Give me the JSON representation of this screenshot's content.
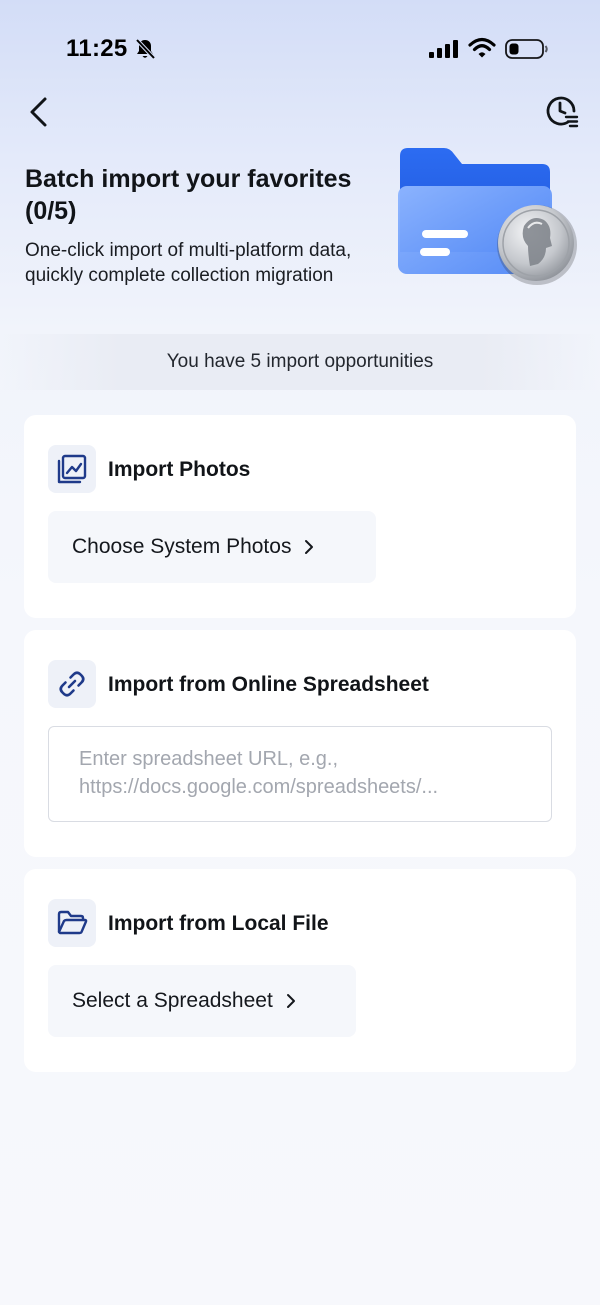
{
  "status_bar": {
    "time": "11:25",
    "icons": [
      "bell-slash-icon",
      "cellular-signal-icon",
      "wifi-icon",
      "battery-low-icon"
    ]
  },
  "nav": {
    "back_icon": "chevron-left-icon",
    "history_icon": "clock-list-icon"
  },
  "hero": {
    "title": "Batch import your favorites (0/5)",
    "subtitle": "One-click import of multi-platform data, quickly complete collection migration",
    "illustration": "folder-with-coin-illustration"
  },
  "banner": {
    "text": "You have 5 import opportunities"
  },
  "cards": {
    "photos": {
      "icon": "photo-icon",
      "title": "Import Photos",
      "action_label": "Choose System Photos"
    },
    "online_spreadsheet": {
      "icon": "link-icon",
      "title": "Import from Online Spreadsheet",
      "url_value": "",
      "url_placeholder": "Enter spreadsheet URL, e.g., https://docs.google.com/spreadsheets/..."
    },
    "local_file": {
      "icon": "folder-open-icon",
      "title": "Import from Local File",
      "action_label": "Select a Spreadsheet"
    }
  },
  "colors": {
    "accent": "#1f3a8a",
    "folder_blue": "#2f6ff0",
    "card_bg": "#ffffff",
    "pill_bg": "#f5f7fb"
  }
}
